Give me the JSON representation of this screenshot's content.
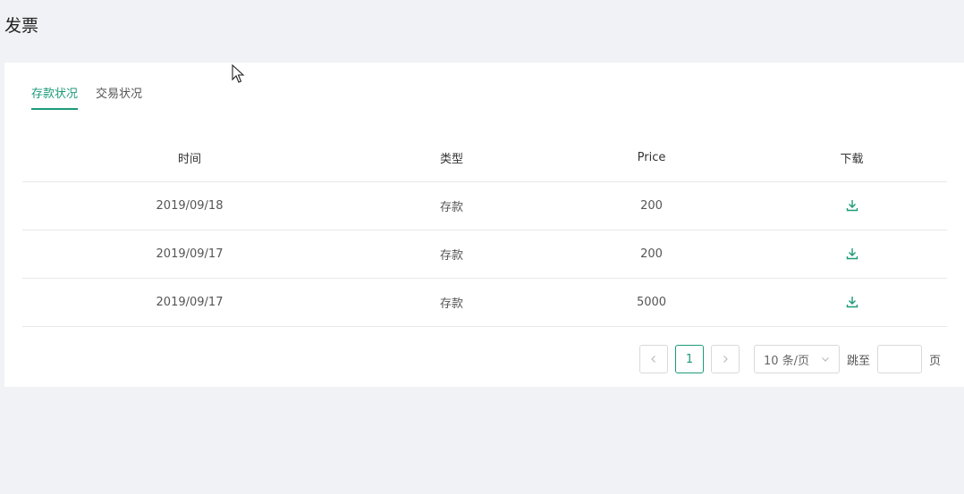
{
  "page": {
    "title": "发票"
  },
  "tabs": [
    {
      "label": "存款状况",
      "active": true
    },
    {
      "label": "交易状况",
      "active": false
    }
  ],
  "table": {
    "columns": [
      "时间",
      "类型",
      "Price",
      "下载"
    ],
    "rows": [
      {
        "date": "2019/09/18",
        "type": "存款",
        "price": "200",
        "download_icon": "download-icon"
      },
      {
        "date": "2019/09/17",
        "type": "存款",
        "price": "200",
        "download_icon": "download-icon"
      },
      {
        "date": "2019/09/17",
        "type": "存款",
        "price": "5000",
        "download_icon": "download-icon"
      }
    ]
  },
  "pagination": {
    "current_page": "1",
    "page_size": "10 条/页",
    "jump_label": "跳至",
    "jump_suffix": "页",
    "jump_value": ""
  },
  "colors": {
    "accent": "#1d9a78",
    "background": "#f0f2f5"
  }
}
